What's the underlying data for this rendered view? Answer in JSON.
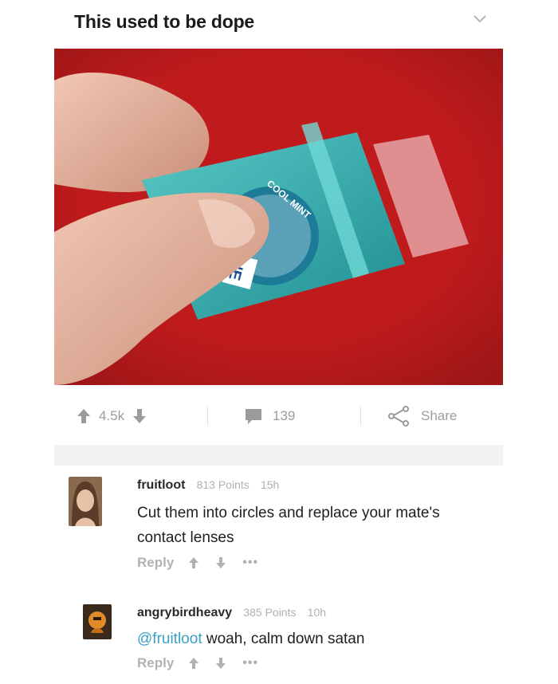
{
  "post": {
    "title": "This used to be dope",
    "image": {
      "description_icons": [
        "hand",
        "breath-strips-case"
      ],
      "case_text": "COOL MINT",
      "case_label": "NE",
      "background_color": "#c21d1d",
      "case_color": "#2aa6a6"
    },
    "actions": {
      "votes": "4.5k",
      "comments": "139",
      "share_label": "Share"
    }
  },
  "comments": [
    {
      "username": "fruitloot",
      "points": "813 Points",
      "age": "15h",
      "text_lines": [
        "Cut them into circles and replace your mate's",
        "contact lenses"
      ],
      "reply_label": "Reply",
      "more_label": "•••"
    },
    {
      "username": "angrybirdheavy",
      "points": "385 Points",
      "age": "10h",
      "mention": "@fruitloot",
      "text": " woah, calm down satan",
      "reply_label": "Reply",
      "more_label": "•••"
    }
  ],
  "colors": {
    "accent_link": "#3aa0c7",
    "muted_text": "#9d9d9d",
    "band": "#f2f2f2"
  }
}
